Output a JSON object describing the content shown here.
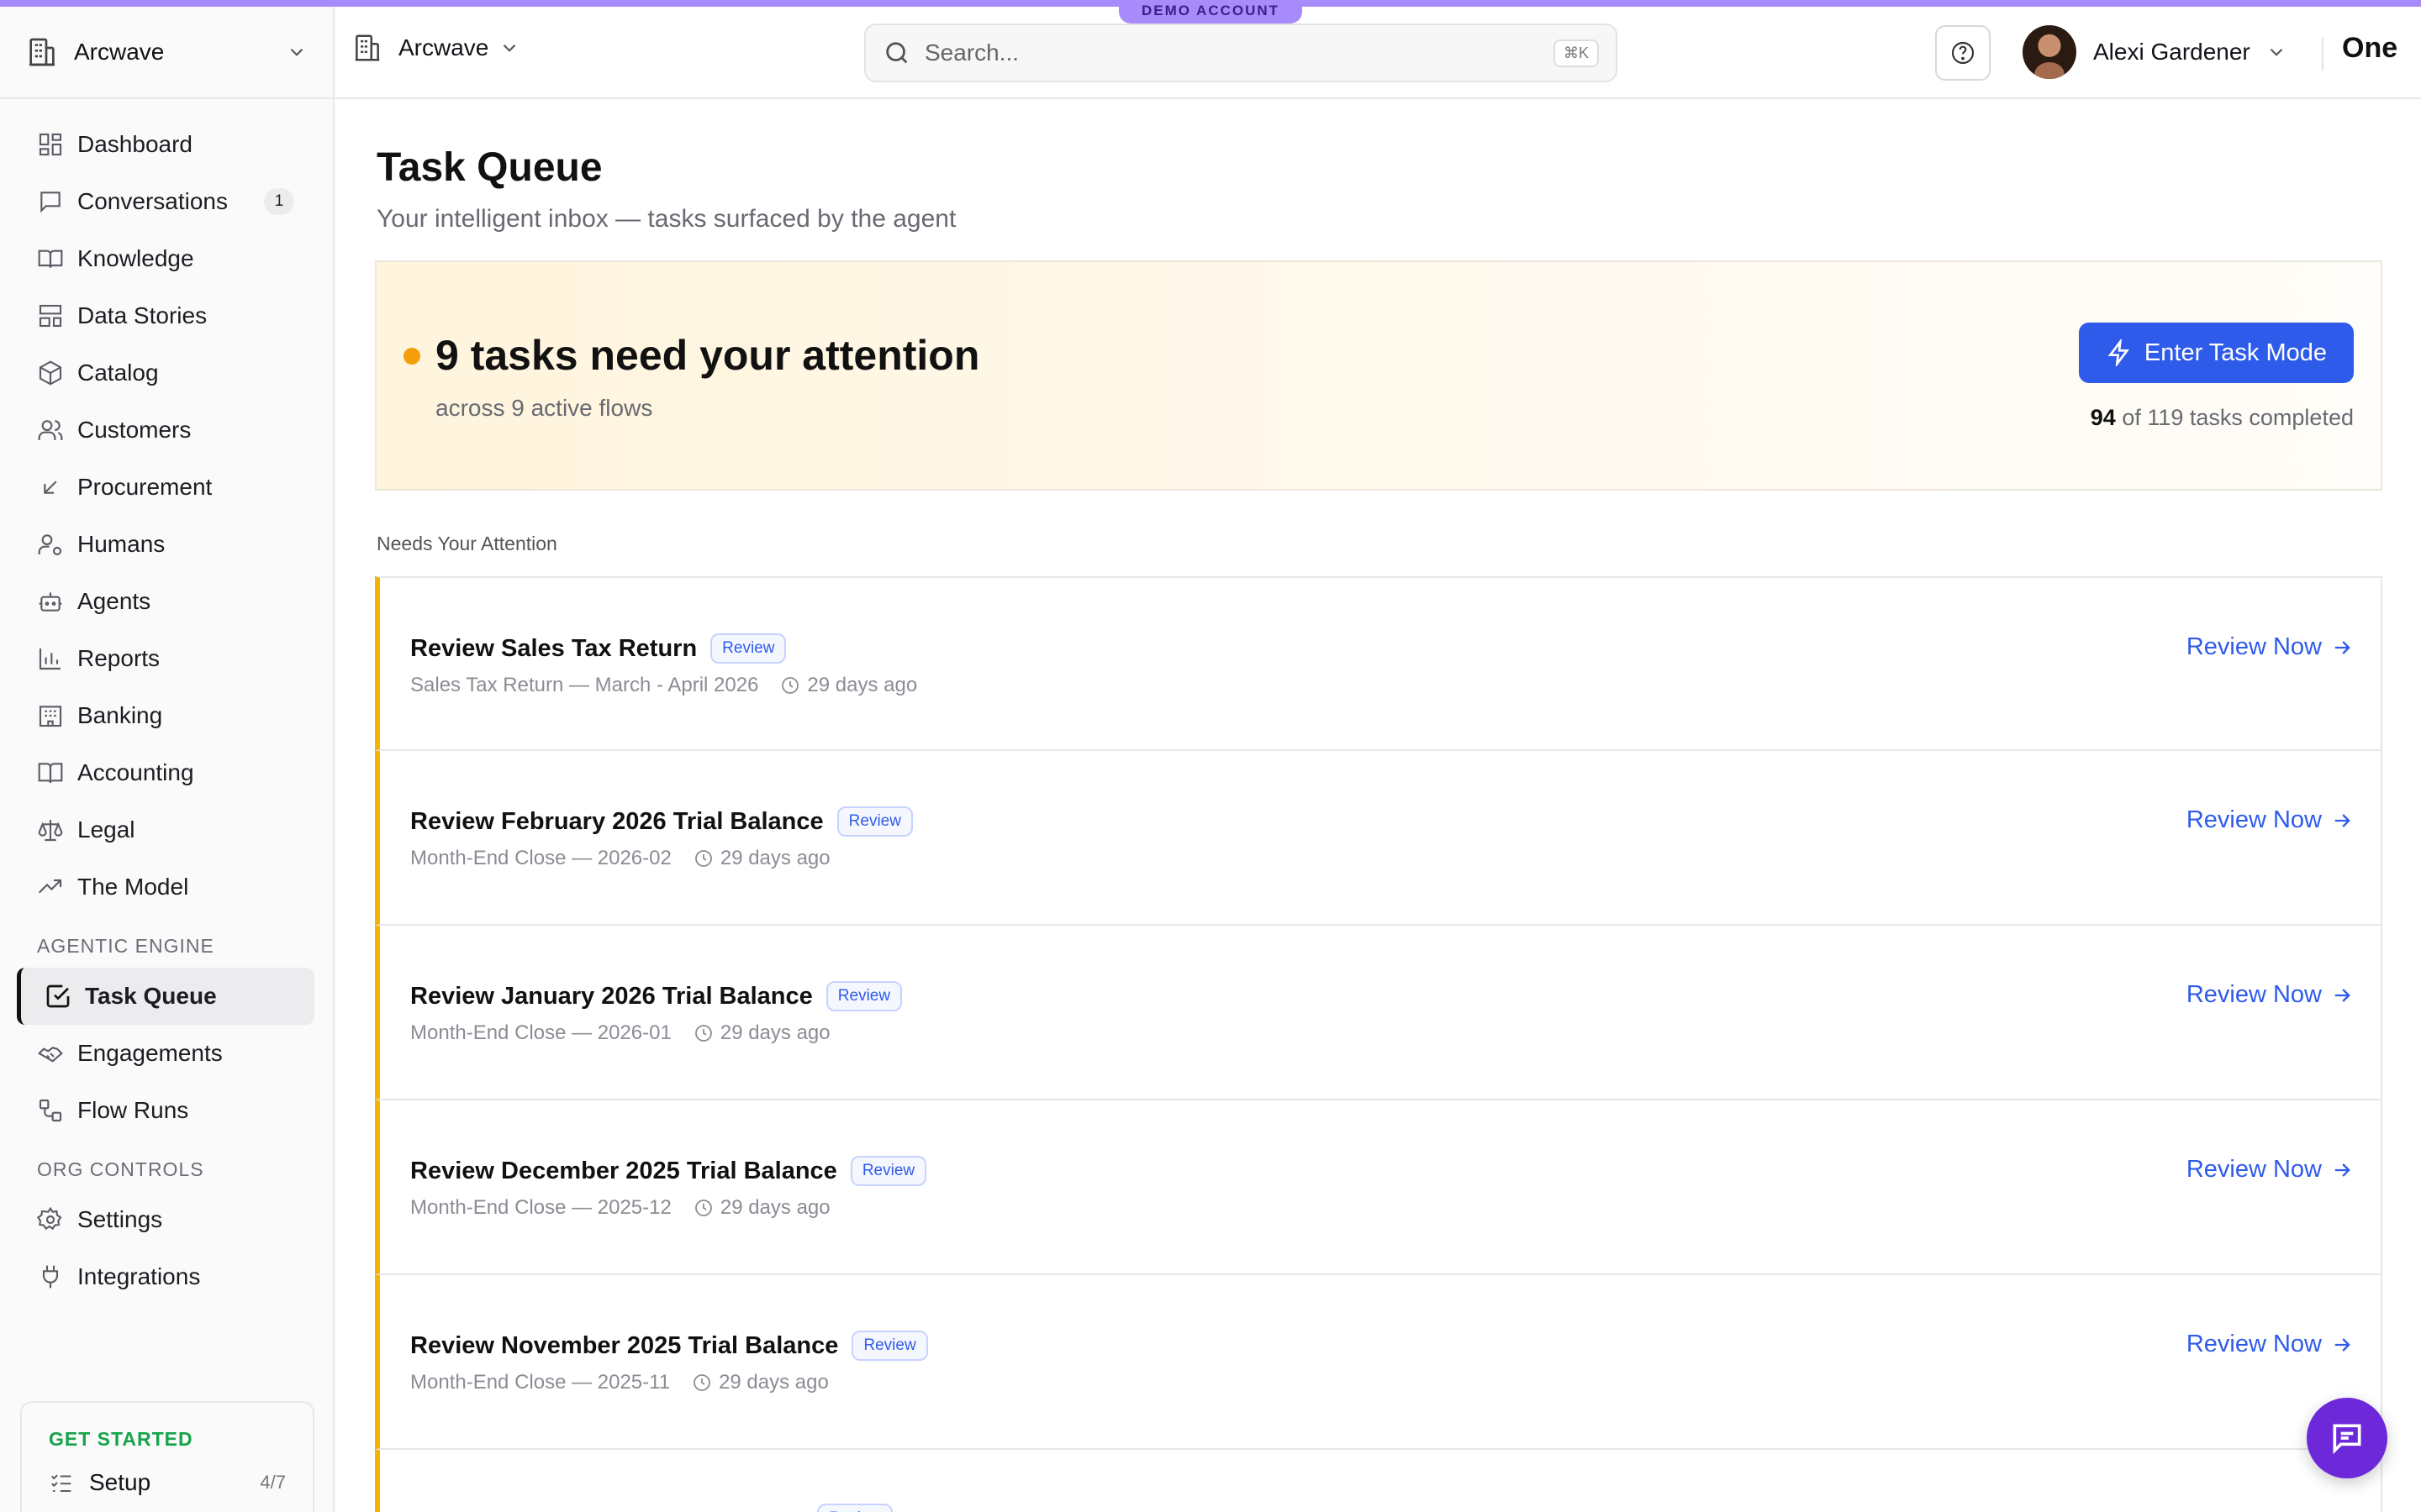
{
  "demo_badge": "DEMO ACCOUNT",
  "sidebar": {
    "org_name": "Arcwave",
    "items": [
      {
        "label": "Dashboard",
        "icon": "dashboard-icon"
      },
      {
        "label": "Conversations",
        "icon": "chat-icon",
        "count": "1"
      },
      {
        "label": "Knowledge",
        "icon": "book-open-icon"
      },
      {
        "label": "Data Stories",
        "icon": "layout-icon"
      },
      {
        "label": "Catalog",
        "icon": "box-icon"
      },
      {
        "label": "Customers",
        "icon": "users-icon"
      },
      {
        "label": "Procurement",
        "icon": "arrow-down-left-icon"
      },
      {
        "label": "Humans",
        "icon": "user-cog-icon"
      },
      {
        "label": "Agents",
        "icon": "robot-icon"
      },
      {
        "label": "Reports",
        "icon": "bar-chart-icon"
      },
      {
        "label": "Banking",
        "icon": "bank-icon"
      },
      {
        "label": "Accounting",
        "icon": "book-icon"
      },
      {
        "label": "Legal",
        "icon": "scale-icon"
      },
      {
        "label": "The Model",
        "icon": "trending-up-icon"
      }
    ],
    "agentic_title": "AGENTIC ENGINE",
    "agentic_items": [
      {
        "label": "Task Queue",
        "icon": "check-square-icon",
        "active": true
      },
      {
        "label": "Engagements",
        "icon": "handshake-icon"
      },
      {
        "label": "Flow Runs",
        "icon": "workflow-icon"
      }
    ],
    "org_title": "ORG CONTROLS",
    "org_items": [
      {
        "label": "Settings",
        "icon": "gear-icon"
      },
      {
        "label": "Integrations",
        "icon": "plug-icon"
      }
    ],
    "get_started": {
      "title": "GET STARTED",
      "setup_label": "Setup",
      "setup_progress": "4/7"
    }
  },
  "topbar": {
    "org_name": "Arcwave",
    "search_placeholder": "Search...",
    "search_shortcut": "⌘K",
    "user_name": "Alexi Gardener",
    "brand": "One"
  },
  "main": {
    "title": "Task Queue",
    "subtitle": "Your intelligent inbox — tasks surfaced by the agent",
    "hero": {
      "headline": "9 tasks need your attention",
      "sub": "across 9 active flows",
      "button_label": "Enter Task Mode",
      "completed_count": "94",
      "completed_rest": " of 119 tasks completed"
    },
    "section_label": "Needs Your Attention",
    "tasks": [
      {
        "title": "Review Sales Tax Return",
        "badge": "Review",
        "meta": "Sales Tax Return — March - April 2026",
        "age": "29 days ago",
        "action": "Review Now"
      },
      {
        "title": "Review February 2026 Trial Balance",
        "badge": "Review",
        "meta": "Month-End Close — 2026-02",
        "age": "29 days ago",
        "action": "Review Now"
      },
      {
        "title": "Review January 2026 Trial Balance",
        "badge": "Review",
        "meta": "Month-End Close — 2026-01",
        "age": "29 days ago",
        "action": "Review Now"
      },
      {
        "title": "Review December 2025 Trial Balance",
        "badge": "Review",
        "meta": "Month-End Close — 2025-12",
        "age": "29 days ago",
        "action": "Review Now"
      },
      {
        "title": "Review November 2025 Trial Balance",
        "badge": "Review",
        "meta": "Month-End Close — 2025-11",
        "age": "29 days ago",
        "action": "Review Now"
      },
      {
        "title": "",
        "badge": "Review",
        "meta": "",
        "age": "",
        "action": ""
      }
    ]
  },
  "colors": {
    "accent": "#2f5bea",
    "attention_bar": "#f5b400",
    "status_dot": "#f59e0b",
    "chat_fab": "#6d28d9",
    "top_strip": "#a78bfa"
  }
}
